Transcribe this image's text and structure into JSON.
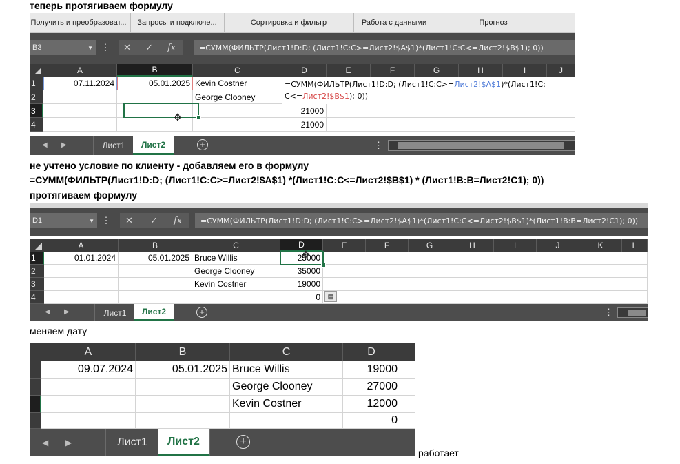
{
  "captions": {
    "step1": "теперь протягиваем формулу",
    "step2a": "не учтено условие по клиенту - добавляем его в формулу",
    "step2b": "=СУММ(ФИЛЬТР(Лист1!D:D; (Лист1!C:C>=Лист2!$A$1) *(Лист1!C:C<=Лист2!$B$1) * (Лист1!B:B=Лист2!C1); 0))",
    "step2c": "протягиваем формулу",
    "step3": "меняем дату",
    "final": "работает"
  },
  "ribbon_groups": [
    "Получить и преобразоват...",
    "Запросы и подключе...",
    "Сортировка и фильтр",
    "Работа с данными",
    "Прогноз"
  ],
  "shot1": {
    "namebox": "B3",
    "formula": "=СУММ(ФИЛЬТР(Лист1!D:D; (Лист1!C:C>=Лист2!$A$1)*(Лист1!C:C<=Лист2!$B$1); 0))",
    "columns": [
      "A",
      "B",
      "C",
      "D",
      "E",
      "F",
      "G",
      "H",
      "I",
      "J"
    ],
    "rows": [
      "1",
      "2",
      "3",
      "4"
    ],
    "cells": {
      "a1": "07.11.2024",
      "b1": "05.01.2025",
      "c1": "Kevin Costner",
      "c2": "George Clooney",
      "d3": "21000",
      "d4": "21000",
      "edit_p1": "=СУММ(ФИЛЬТР(Лист1!D:D; (Лист1!C:C>=",
      "edit_ref1": "Лист2!$A$1",
      "edit_p2": ")*(Лист1!C:",
      "edit_p3": "C<=",
      "edit_ref2": "Лист2!$B$1",
      "edit_p4": "); 0))"
    },
    "tabs": [
      "Лист1",
      "Лист2"
    ]
  },
  "shot2": {
    "namebox": "D1",
    "formula": "=СУММ(ФИЛЬТР(Лист1!D:D; (Лист1!C:C>=Лист2!$A$1)*(Лист1!C:C<=Лист2!$B$1)*(Лист1!B:B=Лист2!C1); 0))",
    "columns": [
      "A",
      "B",
      "C",
      "D",
      "E",
      "F",
      "G",
      "H",
      "I",
      "J",
      "K",
      "L"
    ],
    "rows": [
      "1",
      "2",
      "3",
      "4"
    ],
    "cells": {
      "a1": "01.01.2024",
      "b1": "05.01.2025",
      "c1": "Bruce Willis",
      "c2": "George Clooney",
      "c3": "Kevin Costner",
      "d1": "25000",
      "d2": "35000",
      "d3": "19000",
      "d4": "0"
    },
    "tabs": [
      "Лист1",
      "Лист2"
    ]
  },
  "shot3": {
    "columns": [
      "A",
      "B",
      "C",
      "D"
    ],
    "cells": {
      "a1": "09.07.2024",
      "b1": "05.01.2025",
      "c1": "Bruce Willis",
      "c2": "George Clooney",
      "c3": "Kevin Costner",
      "d1": "19000",
      "d2": "27000",
      "d3": "12000",
      "d4": "0"
    },
    "tabs": [
      "Лист1",
      "Лист2"
    ]
  },
  "colors": {
    "accent": "#217346",
    "ref_blue": "#4f7bd8",
    "ref_red": "#d64545"
  }
}
